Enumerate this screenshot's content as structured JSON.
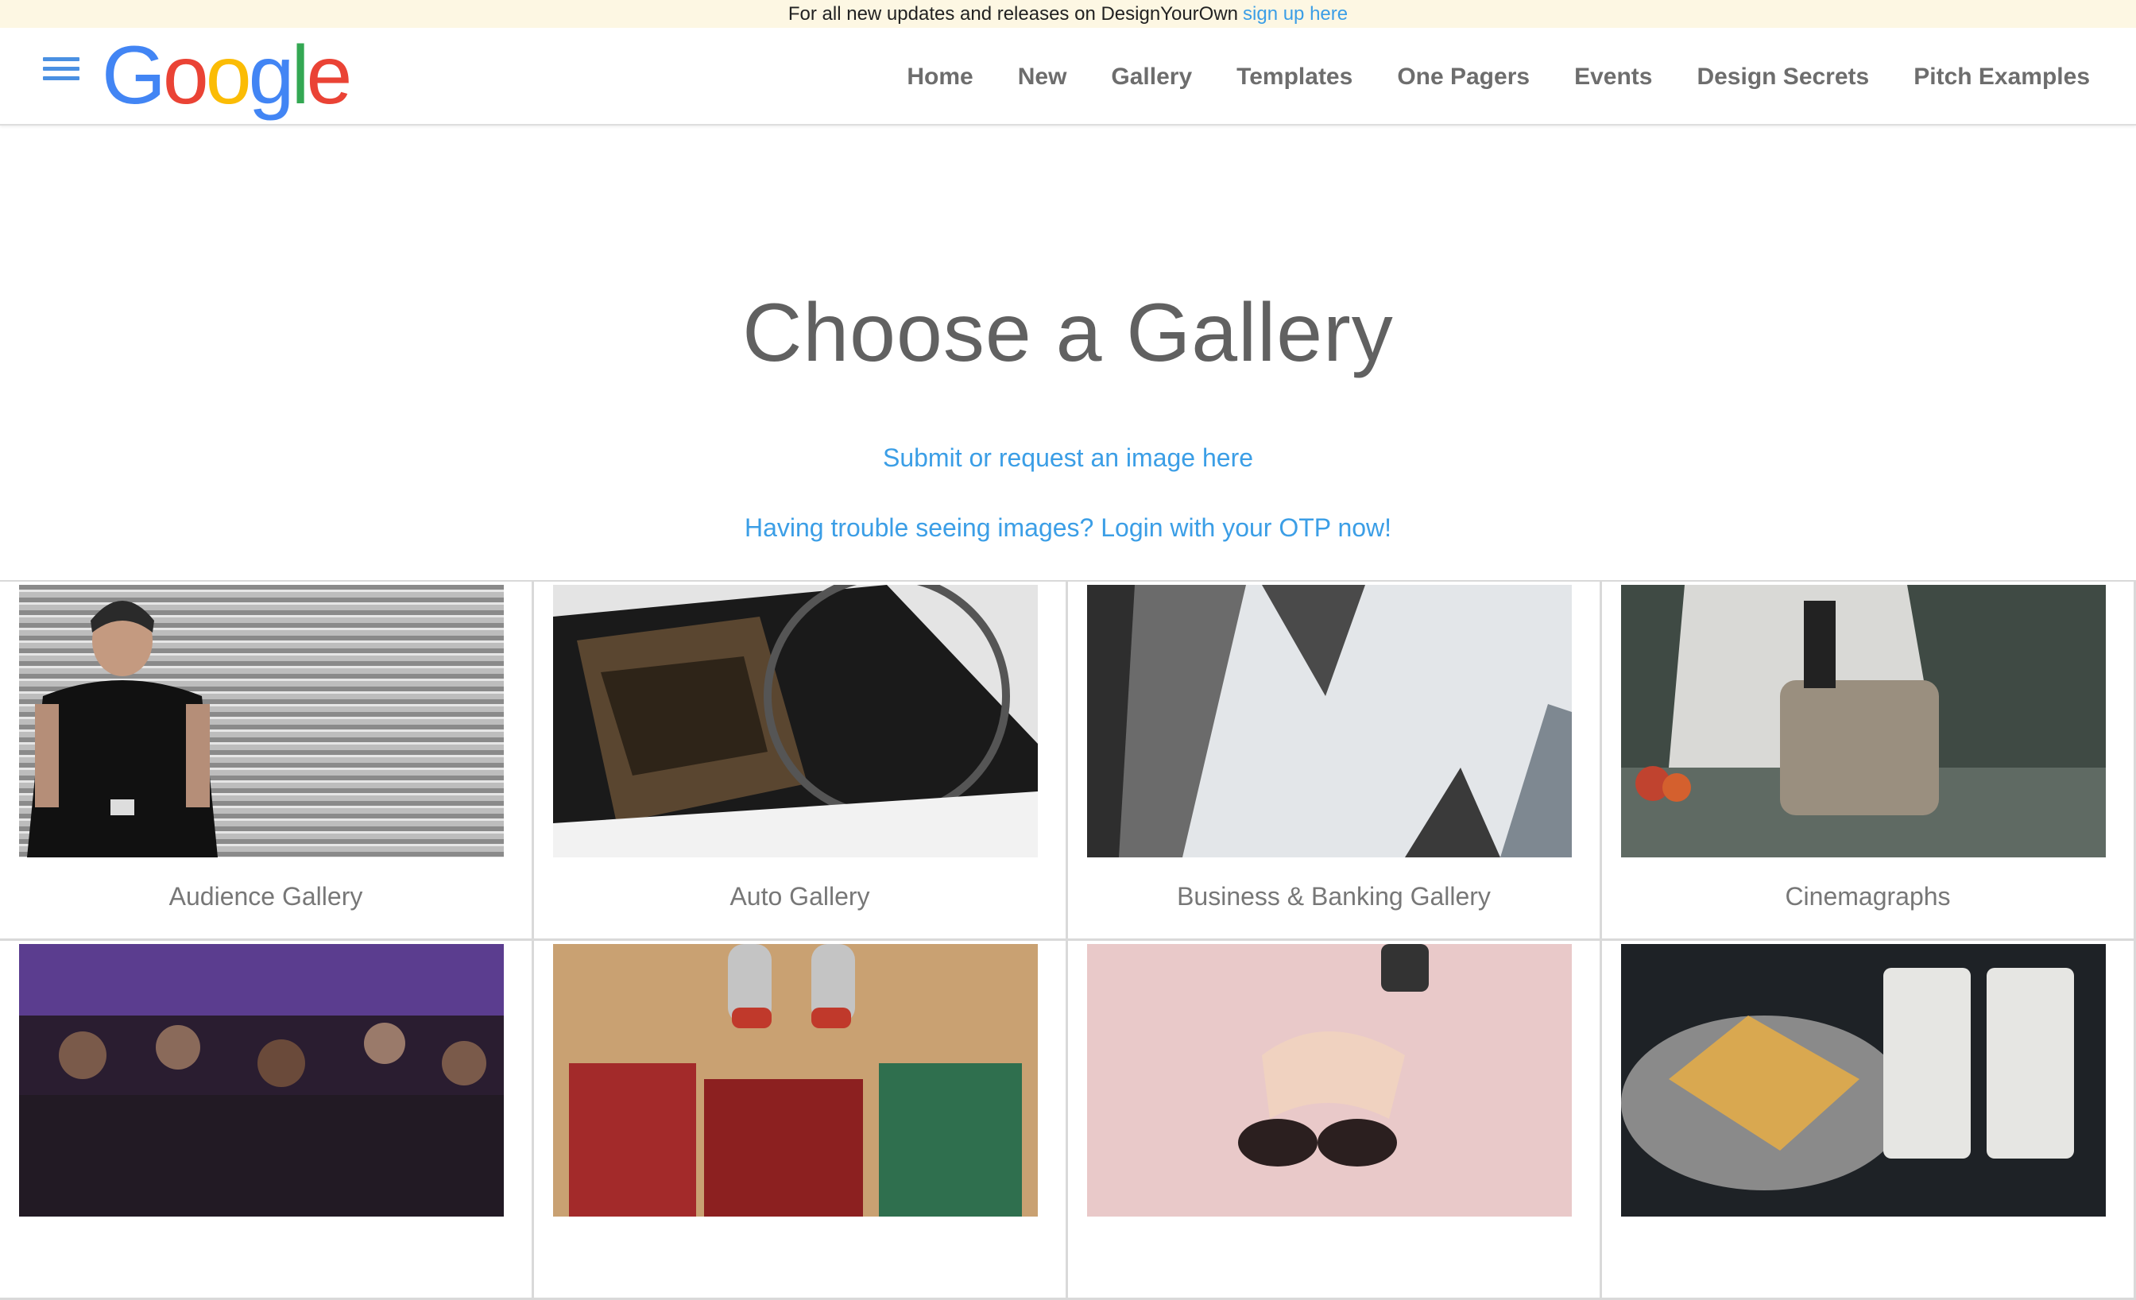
{
  "announcement": {
    "text": "For all new updates and releases on DesignYourOwn",
    "link": "sign up here"
  },
  "logo": {
    "letters": [
      "G",
      "o",
      "o",
      "g",
      "l",
      "e"
    ],
    "colors": [
      "#4285F4",
      "#EA4335",
      "#FBBC05",
      "#4285F4",
      "#34A853",
      "#EA4335"
    ]
  },
  "nav": [
    "Home",
    "New",
    "Gallery",
    "Templates",
    "One Pagers",
    "Events",
    "Design Secrets",
    "Pitch Examples"
  ],
  "hero": {
    "title": "Choose a Gallery",
    "link1": "Submit or request an image here",
    "link2": "Having trouble seeing images? Login with your OTP now!"
  },
  "galleries": [
    {
      "label": "Audience Gallery"
    },
    {
      "label": "Auto Gallery"
    },
    {
      "label": "Business & Banking Gallery"
    },
    {
      "label": "Cinemagraphs"
    },
    {
      "label": ""
    },
    {
      "label": ""
    },
    {
      "label": ""
    },
    {
      "label": ""
    }
  ],
  "colors": {
    "accent_link": "#3b9ee6",
    "nav_text": "#6d6d6d",
    "banner_bg": "#fdf7e3",
    "hamburger": "#4a90e2"
  }
}
